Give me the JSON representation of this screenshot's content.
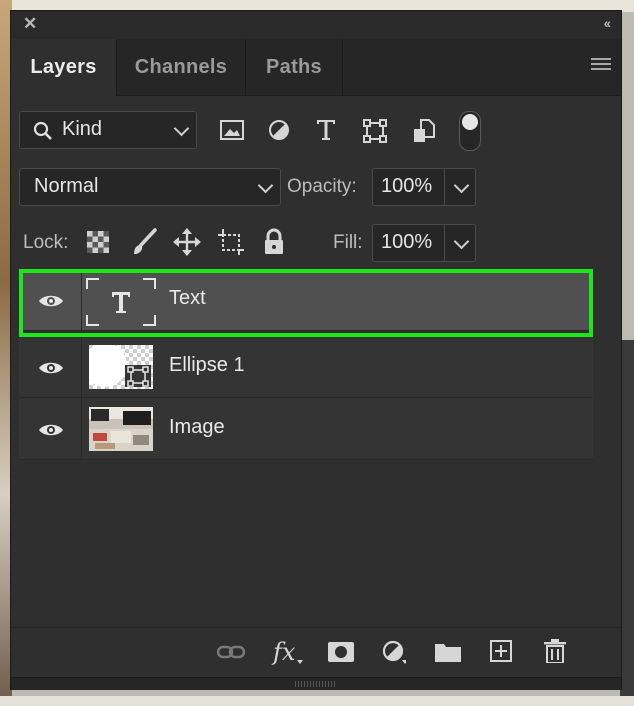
{
  "window": {
    "close_glyph": "✕",
    "collapse_glyph": "‹‹"
  },
  "tabs": [
    {
      "label": "Layers",
      "active": true
    },
    {
      "label": "Channels",
      "active": false
    },
    {
      "label": "Paths",
      "active": false
    }
  ],
  "filter": {
    "kind_label": "Kind",
    "icons": [
      "image-filter-icon",
      "adjustment-filter-icon",
      "type-filter-icon",
      "shape-filter-icon",
      "smart-object-filter-icon",
      "filter-toggle-switch"
    ]
  },
  "blend": {
    "mode": "Normal",
    "opacity_label": "Opacity:",
    "opacity_value": "100%"
  },
  "lock": {
    "label": "Lock:",
    "icons": [
      "lock-transparent-pixels-icon",
      "lock-image-pixels-icon",
      "lock-position-icon",
      "lock-artboard-icon",
      "lock-all-icon"
    ],
    "fill_label": "Fill:",
    "fill_value": "100%"
  },
  "layers": [
    {
      "name": "Text",
      "type": "text",
      "selected": true,
      "visible": true
    },
    {
      "name": "Ellipse 1",
      "type": "shape",
      "selected": false,
      "visible": true
    },
    {
      "name": "Image",
      "type": "image",
      "selected": false,
      "visible": true
    }
  ],
  "bottom_toolbar": {
    "icons": [
      "link-layers-icon",
      "fx-icon",
      "add-mask-icon",
      "new-adjustment-icon",
      "new-group-icon",
      "new-layer-icon",
      "delete-layer-icon"
    ],
    "fx_text": "fx"
  },
  "colors": {
    "highlight": "#1de61d",
    "panel_bg": "#2f2f2f",
    "selected_row": "#505050"
  }
}
